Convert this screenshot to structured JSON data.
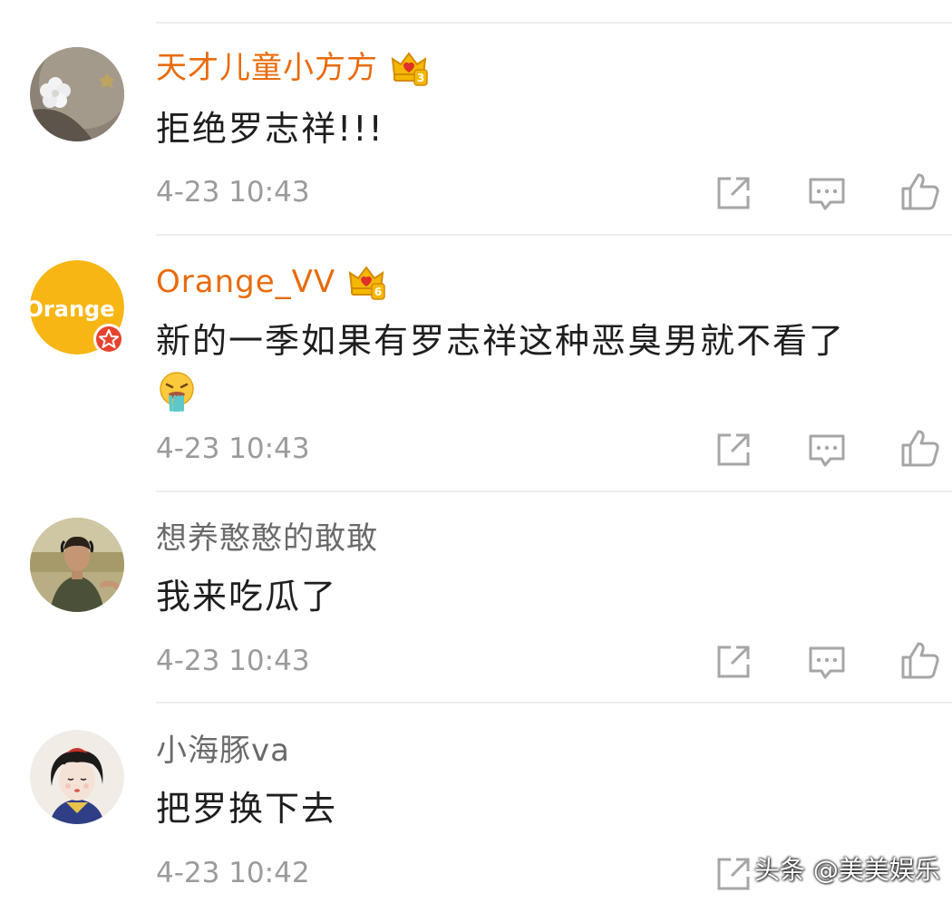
{
  "colors": {
    "vip_name": "#e86b0c",
    "normal_name": "#6a6a6a",
    "content_text": "#1e1e1e",
    "timestamp": "#9b9b9b",
    "divider": "#eeeeee",
    "icon": "#a6a6a6"
  },
  "comments": [
    {
      "username": "天才儿童小方方",
      "vip": true,
      "vip_level": "3",
      "content": "拒绝罗志祥!!!",
      "timestamp": "4-23 10:43",
      "icons": [
        "share-icon",
        "reply-icon",
        "like-icon"
      ]
    },
    {
      "username": "Orange_VV",
      "vip": true,
      "vip_level": "6",
      "avatar_text": "Orange",
      "content": "新的一季如果有罗志祥这种恶臭男就不看了",
      "emoji": "vomit-emoji-icon",
      "timestamp": "4-23 10:43",
      "icons": [
        "share-icon",
        "reply-icon",
        "like-icon"
      ]
    },
    {
      "username": "想养憨憨的敢敢",
      "vip": false,
      "content": "我来吃瓜了",
      "timestamp": "4-23 10:43",
      "icons": [
        "share-icon",
        "reply-icon",
        "like-icon"
      ]
    },
    {
      "username": "小海豚va",
      "vip": false,
      "content": "把罗换下去",
      "timestamp": "4-23 10:42",
      "icons": [
        "share-icon"
      ]
    }
  ],
  "watermark": "头条 @美美娱乐"
}
